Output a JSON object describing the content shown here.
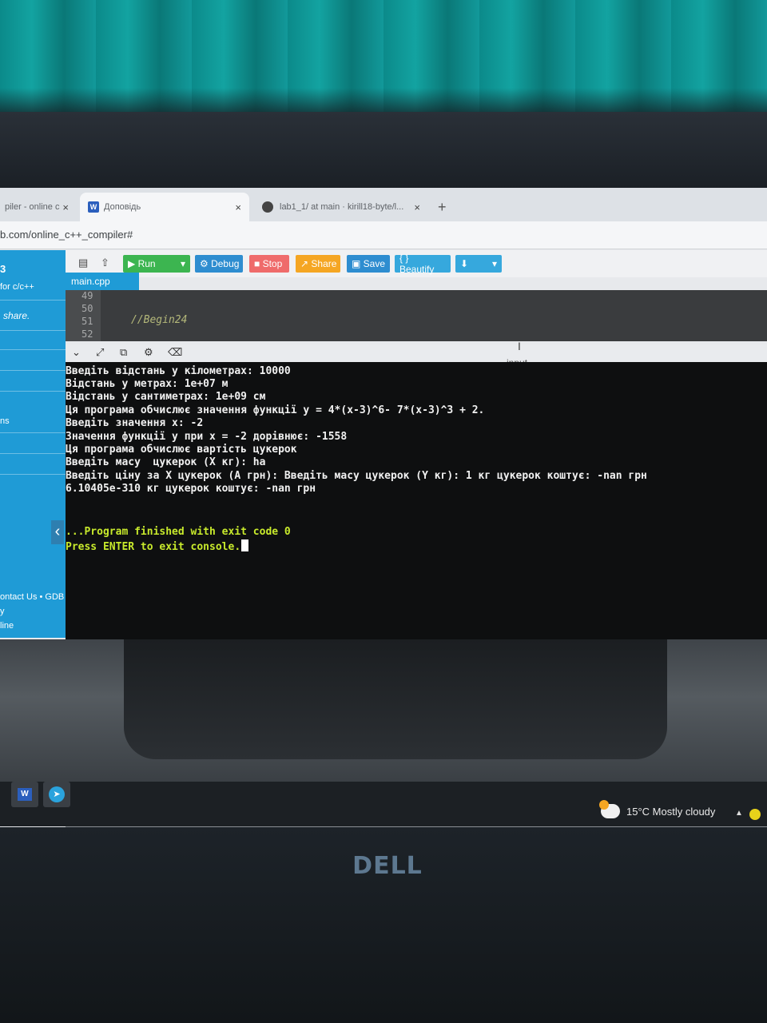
{
  "browser": {
    "tabs": [
      {
        "label": "piler - online c",
        "close": "×"
      },
      {
        "label": "Доповідь",
        "close": "×"
      },
      {
        "label": "lab1_1/ at main · kirill18-byte/l...",
        "close": "×"
      }
    ],
    "new_tab": "+",
    "url": "b.com/online_c++_compiler#"
  },
  "sidebar": {
    "title": "3",
    "subtitle": "for c/c++",
    "share": "share.",
    "ns": "ns",
    "footer": [
      "ontact Us • GDB",
      "y",
      "line"
    ],
    "collapse": "‹"
  },
  "toolbar": {
    "run": "Run",
    "debug": "Debug",
    "stop": "Stop",
    "share": "Share",
    "save": "Save",
    "beautify": "{ } Beautify",
    "colors": {
      "run": "#3cb550",
      "debug": "#2e8dd0",
      "stop": "#ef6b6b",
      "share": "#f5a623",
      "save": "#2e8dd0",
      "beautify": "#36a8dd",
      "download": "#36a8dd"
    }
  },
  "editor": {
    "filename": "main.cpp",
    "lines": [
      {
        "no": "49",
        "code": ""
      },
      {
        "no": "50",
        "code": ""
      },
      {
        "no": "51",
        "code": "//Begin24"
      },
      {
        "no": "52",
        "code": ""
      }
    ]
  },
  "console": {
    "input_label": "input",
    "output": [
      "Введіть відстань у кілометрах: 10000",
      "Відстань у метрах: 1e+07 м",
      "Відстань у сантиметрах: 1e+09 см",
      "Ця програма обчислює значення функції y = 4*(x-3)^6- 7*(x-3)^3 + 2.",
      "Введіть значення x: -2",
      "Значення функції y при x = -2 дорівнює: -1558",
      "Ця програма обчислює вартість цукерок",
      "Введіть масу  цукерок (X кг): ha",
      "Введіть ціну за X цукерок (A грн): Введіть масу цукерок (Y кг): 1 кг цукерок коштує: -nan грн",
      "6.10405e-310 кг цукерок коштує: -nan грн"
    ],
    "finish": "...Program finished with exit code 0",
    "prompt": "Press ENTER to exit console."
  },
  "taskbar": {
    "weather": "15°C  Mostly cloudy",
    "word": "W",
    "telegram": "➤"
  },
  "device": {
    "logo": "DELL"
  }
}
